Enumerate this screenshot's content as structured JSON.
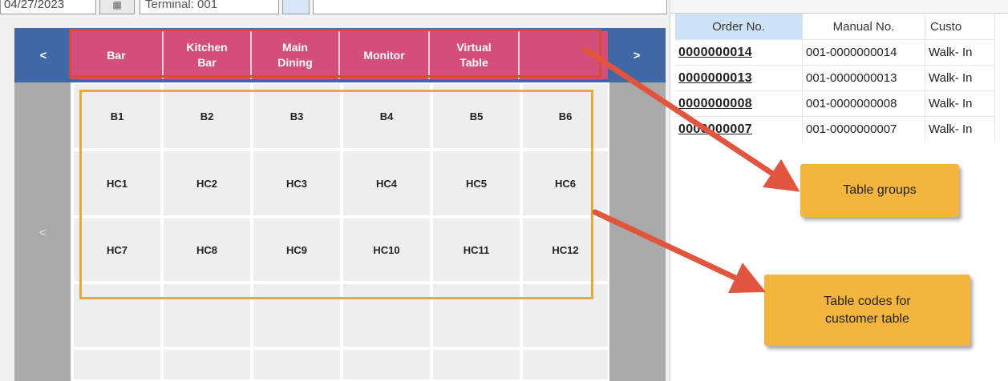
{
  "toolbar": {
    "date_value": "04/27/2023",
    "terminal_value": "Terminal: 001"
  },
  "group_nav": {
    "prev_label": "<",
    "next_label": ">"
  },
  "groups": [
    {
      "line1": "Bar",
      "line2": ""
    },
    {
      "line1": "Kitchen",
      "line2": "Bar"
    },
    {
      "line1": "Main",
      "line2": "Dining"
    },
    {
      "line1": "Monitor",
      "line2": ""
    },
    {
      "line1": "Virtual",
      "line2": "Table"
    },
    {
      "line1": "",
      "line2": ""
    }
  ],
  "table_nav": {
    "prev_label": "<",
    "next_label": ">"
  },
  "tables": [
    [
      "B1",
      "B2",
      "B3",
      "B4",
      "B5",
      "B6"
    ],
    [
      "HC1",
      "HC2",
      "HC3",
      "HC4",
      "HC5",
      "HC6"
    ],
    [
      "HC7",
      "HC8",
      "HC9",
      "HC10",
      "HC11",
      "HC12"
    ],
    [
      "",
      "",
      "",
      "",
      "",
      ""
    ],
    [
      "",
      "",
      "",
      "",
      "",
      ""
    ],
    [
      "",
      "",
      "",
      "",
      "",
      ""
    ]
  ],
  "orders": {
    "columns": [
      "Order No.",
      "Manual No.",
      "Custo"
    ],
    "rows": [
      {
        "order_no": "0000000014",
        "manual_no": "001-0000000014",
        "customer": "Walk- In"
      },
      {
        "order_no": "0000000013",
        "manual_no": "001-0000000013",
        "customer": "Walk- In"
      },
      {
        "order_no": "0000000008",
        "manual_no": "001-0000000008",
        "customer": "Walk- In"
      },
      {
        "order_no": "0000000007",
        "manual_no": "001-0000000007",
        "customer": "Walk- In"
      }
    ]
  },
  "callouts": {
    "table_groups": "Table groups",
    "table_codes_line1": "Table codes for",
    "table_codes_line2": "customer table"
  },
  "colors": {
    "group_bar": "#3f68a5",
    "group_button": "#d34f7a",
    "highlight_red": "#d84a37",
    "highlight_yellow": "#e8a93a",
    "callout": "#f3b53d"
  }
}
